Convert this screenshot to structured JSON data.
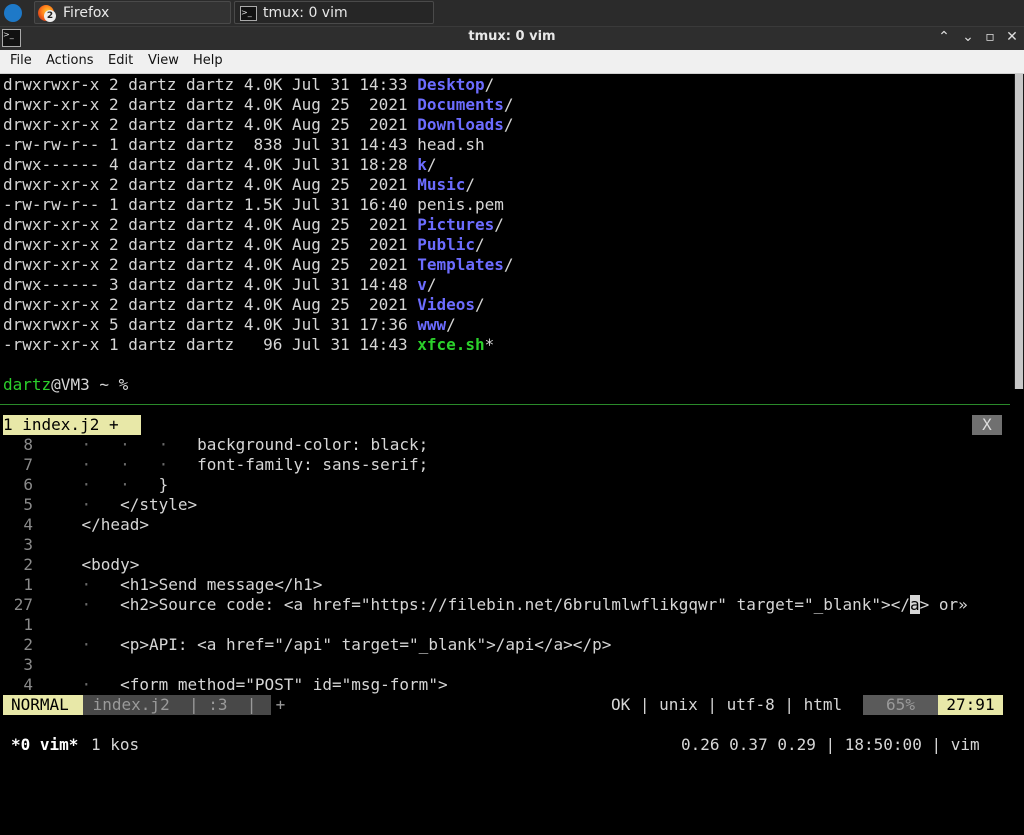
{
  "taskbar": {
    "tasks": [
      {
        "label": "Firefox",
        "badge": "2"
      },
      {
        "label": "tmux: 0 vim",
        "icon_glyph": ">_"
      }
    ]
  },
  "window": {
    "title": "tmux: 0 vim",
    "icon_glyph": ">_",
    "controls": {
      "minimize": "⌃",
      "maximize": "⌄",
      "restore": "▫",
      "close": "✕"
    }
  },
  "menu": [
    "File",
    "Actions",
    "Edit",
    "View",
    "Help"
  ],
  "listing": [
    {
      "perm": "drwxrwxr-x",
      "links": "2",
      "user": "dartz",
      "group": "dartz",
      "size": "4.0K",
      "mon": "Jul",
      "day": "31",
      "time": "14:33",
      "name": "Desktop",
      "type": "dir"
    },
    {
      "perm": "drwxr-xr-x",
      "links": "2",
      "user": "dartz",
      "group": "dartz",
      "size": "4.0K",
      "mon": "Aug",
      "day": "25",
      "time": " 2021",
      "name": "Documents",
      "type": "dir"
    },
    {
      "perm": "drwxr-xr-x",
      "links": "2",
      "user": "dartz",
      "group": "dartz",
      "size": "4.0K",
      "mon": "Aug",
      "day": "25",
      "time": " 2021",
      "name": "Downloads",
      "type": "dir"
    },
    {
      "perm": "-rw-rw-r--",
      "links": "1",
      "user": "dartz",
      "group": "dartz",
      "size": " 838",
      "mon": "Jul",
      "day": "31",
      "time": "14:43",
      "name": "head.sh",
      "type": "file"
    },
    {
      "perm": "drwx------",
      "links": "4",
      "user": "dartz",
      "group": "dartz",
      "size": "4.0K",
      "mon": "Jul",
      "day": "31",
      "time": "18:28",
      "name": "k",
      "type": "dir"
    },
    {
      "perm": "drwxr-xr-x",
      "links": "2",
      "user": "dartz",
      "group": "dartz",
      "size": "4.0K",
      "mon": "Aug",
      "day": "25",
      "time": " 2021",
      "name": "Music",
      "type": "dir"
    },
    {
      "perm": "-rw-rw-r--",
      "links": "1",
      "user": "dartz",
      "group": "dartz",
      "size": "1.5K",
      "mon": "Jul",
      "day": "31",
      "time": "16:40",
      "name": "penis.pem",
      "type": "file"
    },
    {
      "perm": "drwxr-xr-x",
      "links": "2",
      "user": "dartz",
      "group": "dartz",
      "size": "4.0K",
      "mon": "Aug",
      "day": "25",
      "time": " 2021",
      "name": "Pictures",
      "type": "dir"
    },
    {
      "perm": "drwxr-xr-x",
      "links": "2",
      "user": "dartz",
      "group": "dartz",
      "size": "4.0K",
      "mon": "Aug",
      "day": "25",
      "time": " 2021",
      "name": "Public",
      "type": "dir"
    },
    {
      "perm": "drwxr-xr-x",
      "links": "2",
      "user": "dartz",
      "group": "dartz",
      "size": "4.0K",
      "mon": "Aug",
      "day": "25",
      "time": " 2021",
      "name": "Templates",
      "type": "dir"
    },
    {
      "perm": "drwx------",
      "links": "3",
      "user": "dartz",
      "group": "dartz",
      "size": "4.0K",
      "mon": "Jul",
      "day": "31",
      "time": "14:48",
      "name": "v",
      "type": "dir"
    },
    {
      "perm": "drwxr-xr-x",
      "links": "2",
      "user": "dartz",
      "group": "dartz",
      "size": "4.0K",
      "mon": "Aug",
      "day": "25",
      "time": " 2021",
      "name": "Videos",
      "type": "dir"
    },
    {
      "perm": "drwxrwxr-x",
      "links": "5",
      "user": "dartz",
      "group": "dartz",
      "size": "4.0K",
      "mon": "Jul",
      "day": "31",
      "time": "17:36",
      "name": "www",
      "type": "dir"
    },
    {
      "perm": "-rwxr-xr-x",
      "links": "1",
      "user": "dartz",
      "group": "dartz",
      "size": "  96",
      "mon": "Jul",
      "day": "31",
      "time": "14:43",
      "name": "xfce.sh",
      "type": "exe"
    }
  ],
  "prompt": {
    "user": "dartz",
    "rest": "@VM3 ~ %"
  },
  "vim": {
    "tab": "1 index.j2 +",
    "tab_close": "X",
    "lines": [
      {
        "num": "8",
        "indent": "·   ·   ·   ",
        "text": "background-color: black;"
      },
      {
        "num": "7",
        "indent": "·   ·   ·   ",
        "text": "font-family: sans-serif;"
      },
      {
        "num": "6",
        "indent": "·   ·   ",
        "text": "}"
      },
      {
        "num": "5",
        "indent": "·   ",
        "text": "</style>"
      },
      {
        "num": "4",
        "indent": "",
        "text": "</head>"
      },
      {
        "num": "3",
        "indent": "",
        "text": ""
      },
      {
        "num": "2",
        "indent": "",
        "text": "<body>"
      },
      {
        "num": "1",
        "indent": "·   ",
        "text": "<h1>Send message</h1>"
      },
      {
        "num": "27",
        "indent": "·   ",
        "text": "<h2>Source code: <a href=\"https://filebin.net/6brulmlwflikgqwr\" target=\"_blank\"></",
        "cursor": "a",
        "after": "> or»"
      },
      {
        "num": "1",
        "indent": "",
        "text": ""
      },
      {
        "num": "2",
        "indent": "·   ",
        "text": "<p>API: <a href=\"/api\" target=\"_blank\">/api</a></p>"
      },
      {
        "num": "3",
        "indent": "",
        "text": ""
      },
      {
        "num": "4",
        "indent": "·   ",
        "text": "<form method=\"POST\" id=\"msg-form\">"
      }
    ],
    "status": {
      "mode": "NORMAL",
      "file": " index.j2  | :3  |  + ",
      "info": "OK | unix | utf-8 | html",
      "percent": "65%",
      "position": "27:91"
    }
  },
  "tmux": {
    "active_window": "*0 vim*",
    "other_window": "1 kos",
    "right": "0.26 0.37 0.29 | 18:50:00 | vim"
  }
}
